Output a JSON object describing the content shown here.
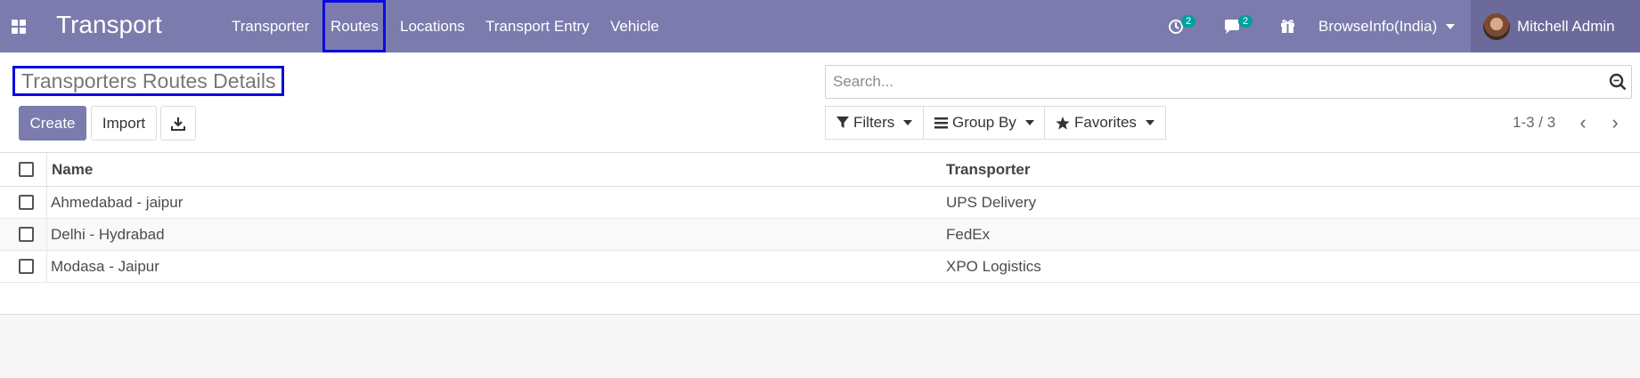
{
  "navbar": {
    "app_title": "Transport",
    "menu": [
      "Transporter",
      "Routes",
      "Locations",
      "Transport Entry",
      "Vehicle"
    ],
    "activity_count": "2",
    "message_count": "2",
    "company": "BrowseInfo(India)",
    "user": "Mitchell Admin"
  },
  "control_panel": {
    "title": "Transporters Routes Details",
    "create_label": "Create",
    "import_label": "Import",
    "search_placeholder": "Search...",
    "filters_label": "Filters",
    "groupby_label": "Group By",
    "favorites_label": "Favorites",
    "pager": "1-3 / 3"
  },
  "table": {
    "columns": [
      "Name",
      "Transporter"
    ],
    "rows": [
      {
        "name": "Ahmedabad - jaipur",
        "transporter": "UPS Delivery"
      },
      {
        "name": "Delhi - Hydrabad",
        "transporter": "FedEx"
      },
      {
        "name": "Modasa - Jaipur",
        "transporter": "XPO Logistics"
      }
    ]
  },
  "colors": {
    "brand": "#7c7bad",
    "highlight_box": "#0a0adf",
    "badge": "#00a09d"
  }
}
